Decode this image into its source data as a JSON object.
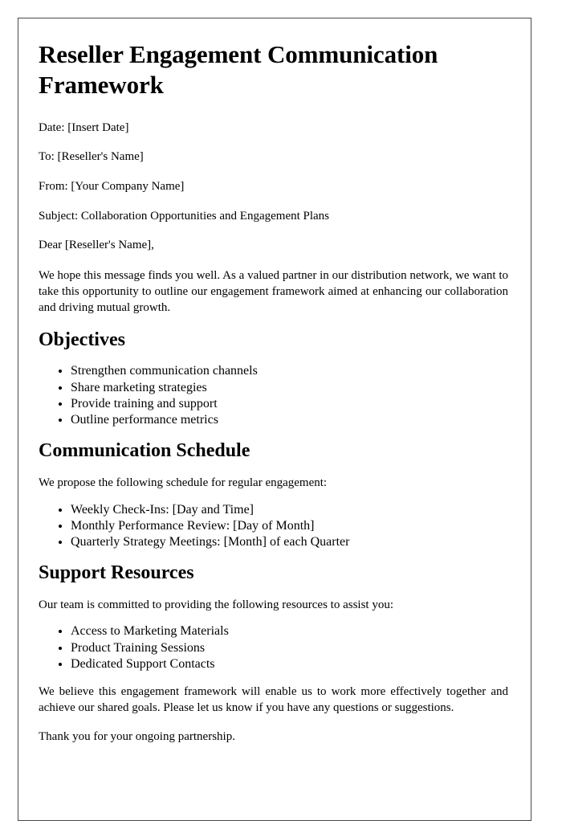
{
  "document": {
    "title": "Reseller Engagement Communication Framework",
    "meta": [
      "Date: [Insert Date]",
      "To: [Reseller's Name]",
      "From: [Your Company Name]",
      "Subject: Collaboration Opportunities and Engagement Plans",
      "Dear [Reseller's Name],"
    ],
    "intro": "We hope this message finds you well. As a valued partner in our distribution network, we want to take this opportunity to outline our engagement framework aimed at enhancing our collaboration and driving mutual growth.",
    "sections": [
      {
        "heading": "Objectives",
        "lead": "",
        "items": [
          "Strengthen communication channels",
          "Share marketing strategies",
          "Provide training and support",
          "Outline performance metrics"
        ]
      },
      {
        "heading": "Communication Schedule",
        "lead": "We propose the following schedule for regular engagement:",
        "items": [
          "Weekly Check-Ins: [Day and Time]",
          "Monthly Performance Review: [Day of Month]",
          "Quarterly Strategy Meetings: [Month] of each Quarter"
        ]
      },
      {
        "heading": "Support Resources",
        "lead": "Our team is committed to providing the following resources to assist you:",
        "items": [
          "Access to Marketing Materials",
          "Product Training Sessions",
          "Dedicated Support Contacts"
        ]
      }
    ],
    "closing": "We believe this engagement framework will enable us to work more effectively together and achieve our shared goals. Please let us know if you have any questions or suggestions.",
    "thanks": "Thank you for your ongoing partnership."
  },
  "colors": {
    "page_background": "#ffffff",
    "text": "#000000",
    "page_border": "#4a4a4a"
  }
}
